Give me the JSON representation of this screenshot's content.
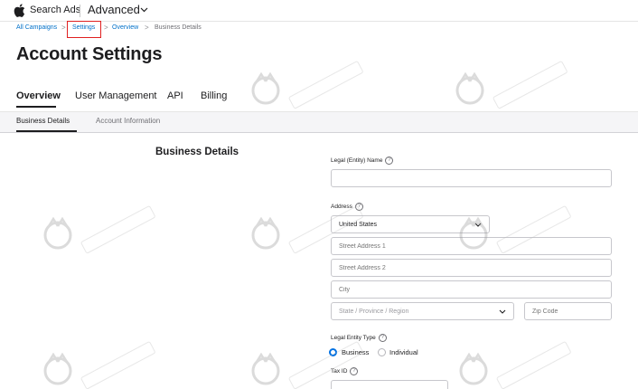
{
  "header": {
    "brand_label": "Search Ads",
    "plan_label": "Advanced",
    "icons": [
      "apple-logo-icon",
      "chevron-down-icon"
    ]
  },
  "breadcrumb": {
    "items": [
      "All Campaigns",
      "Settings",
      "Overview",
      "Business Details"
    ],
    "separator": ">"
  },
  "page": {
    "title": "Account Settings"
  },
  "main_tabs": [
    {
      "label": "Overview",
      "active": true
    },
    {
      "label": "User Management",
      "active": false
    },
    {
      "label": "API",
      "active": false
    },
    {
      "label": "Billing",
      "active": false
    }
  ],
  "sub_tabs": [
    {
      "label": "Business Details",
      "active": true
    },
    {
      "label": "Account Information",
      "active": false
    }
  ],
  "section": {
    "title": "Business Details"
  },
  "form": {
    "legal_name": {
      "label": "Legal (Entity) Name",
      "value": ""
    },
    "address": {
      "label": "Address",
      "country_value": "United States",
      "street1_placeholder": "Street Address 1",
      "street2_placeholder": "Street Address 2",
      "city_placeholder": "City",
      "state_placeholder": "State / Province / Region",
      "zip_placeholder": "Zip Code"
    },
    "entity_type": {
      "label": "Legal Entity Type",
      "options": [
        "Business",
        "Individual"
      ],
      "selected": "Business"
    },
    "tax_id": {
      "label": "Tax ID"
    }
  },
  "colors": {
    "accent": "#0071e3",
    "link": "#0070c9",
    "highlight_box": "#e02020",
    "watermark": "#9a9a9a"
  }
}
